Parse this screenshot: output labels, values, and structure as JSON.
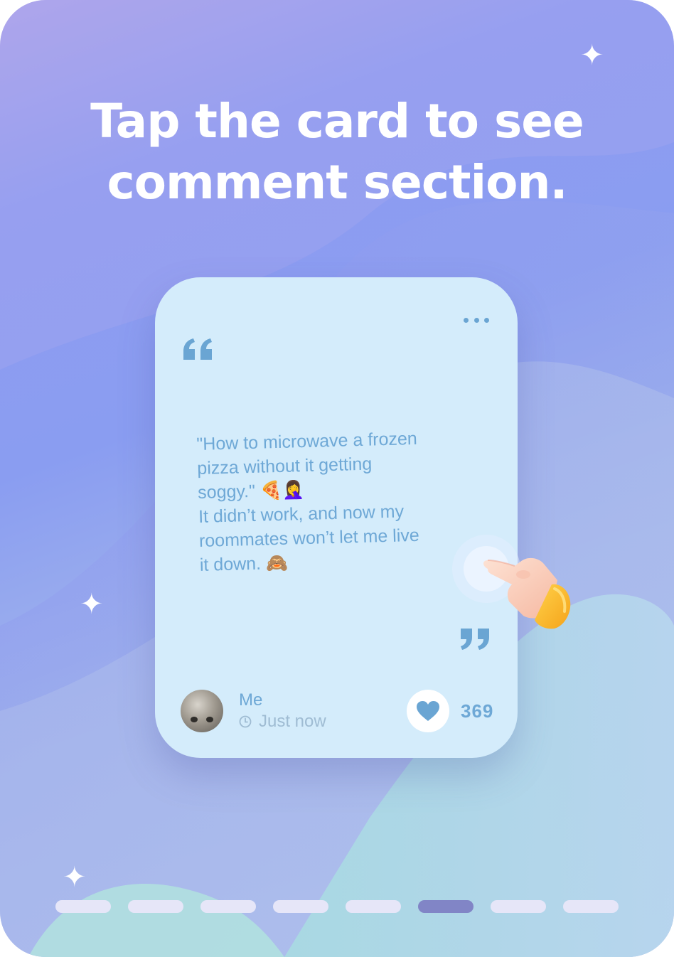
{
  "headline": {
    "line1": "Tap the card to see",
    "line2": "comment section."
  },
  "card": {
    "more_icon": "more-dots-icon",
    "quote_open_icon": "quote-open-icon",
    "quote_close_icon": "quote-close-icon",
    "text_lines": [
      "\"How to microwave a frozen",
      "pizza without it getting",
      "soggy.\" 🍕🤦‍♀️",
      "It didn’t work, and now my",
      "roommates won’t let me live",
      "it down. 🙈"
    ],
    "author": {
      "name": "Me",
      "time": "Just now",
      "time_icon": "clock-icon"
    },
    "likes": {
      "icon": "heart-icon",
      "count": "369"
    }
  },
  "pager": {
    "total": 8,
    "active_index": 5
  },
  "colors": {
    "card_bg": "#d4ecfb",
    "accent": "#6ea8d6",
    "pager_active": "#8185c6",
    "pager_inactive": "#e6e6f8"
  }
}
